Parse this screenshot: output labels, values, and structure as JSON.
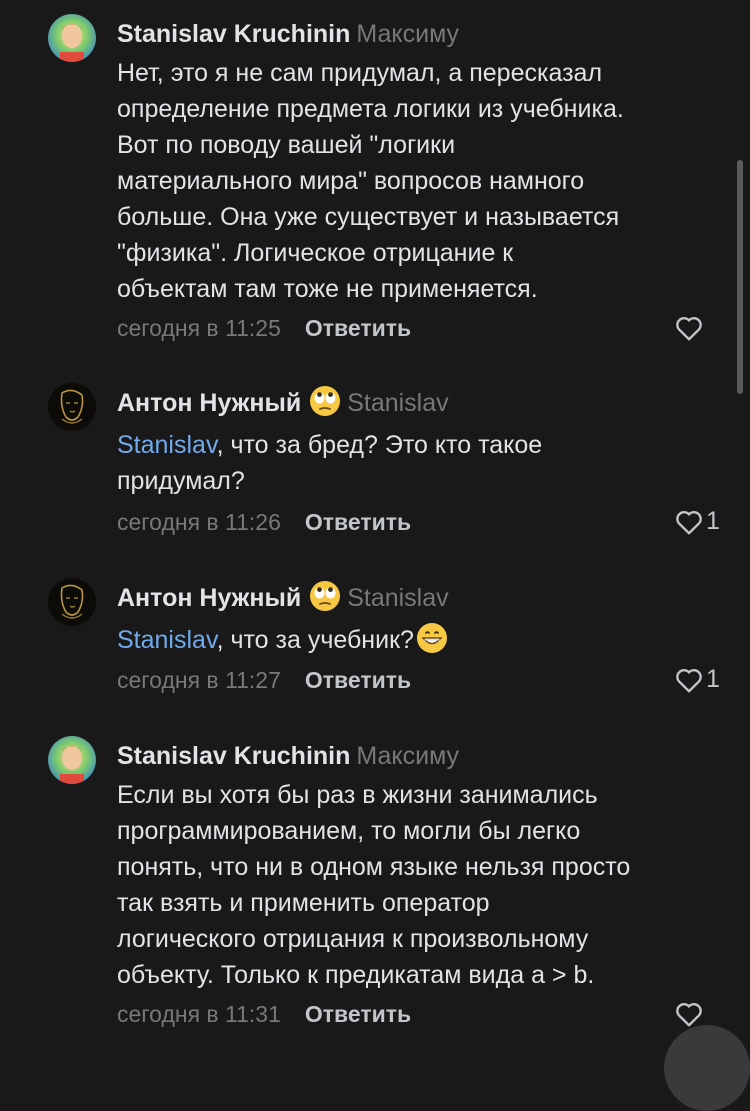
{
  "comments": [
    {
      "author": "Stanislav Kruchinin",
      "reply_to": "Максиму",
      "lines": [
        "Нет, это я не сам придумал,  а пересказал",
        "определение предмета логики из учебника.",
        "Вот по поводу вашей \"логики",
        "материального мира\" вопросов намного",
        "больше. Она уже существует и называется",
        "\"физика\". Логическое отрицание к",
        "объектам там тоже не применяется."
      ],
      "time": "сегодня в 11:25",
      "reply_label": "Ответить",
      "likes": ""
    },
    {
      "author": "Антон Нужный",
      "author_emoji": "eye-roll-emoji",
      "reply_to": "Stanislav",
      "mention": "Stanislav",
      "lines": [
        ", что за бред? Это кто такое",
        "придумал?"
      ],
      "time": "сегодня в 11:26",
      "reply_label": "Ответить",
      "likes": "1"
    },
    {
      "author": "Антон Нужный",
      "author_emoji": "eye-roll-emoji",
      "reply_to": "Stanislav",
      "mention": "Stanislav",
      "lines": [
        ", что за учебник?"
      ],
      "text_emoji": "grinning-emoji",
      "time": "сегодня в 11:27",
      "reply_label": "Ответить",
      "likes": "1"
    },
    {
      "author": "Stanislav Kruchinin",
      "reply_to": "Максиму",
      "lines": [
        "Если вы хотя бы раз в жизни занимались",
        "программированием, то могли бы легко",
        "понять, что ни в одном языке нельзя просто",
        "так взять и применить оператор",
        "логического отрицания к произвольному",
        "объекту. Только к предикатам вида a > b."
      ],
      "time": "сегодня в 11:31",
      "reply_label": "Ответить",
      "likes": ""
    }
  ],
  "icons": {
    "like": "heart-icon"
  },
  "colors": {
    "background": "#19191a",
    "text": "#e1e3e6",
    "secondary": "#76787a",
    "mention": "#71aaeb"
  }
}
